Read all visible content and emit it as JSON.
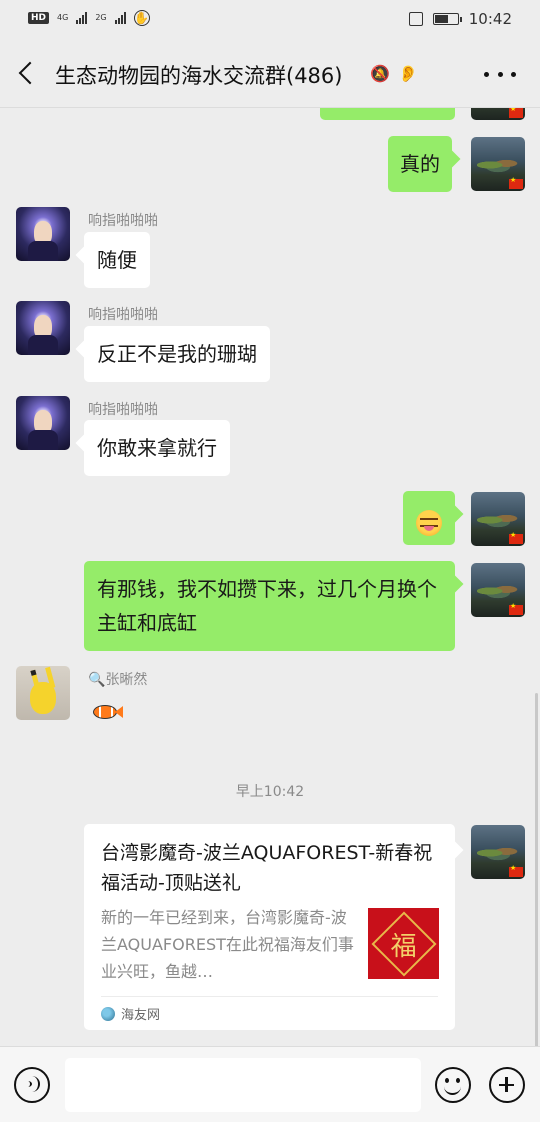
{
  "status_bar": {
    "hd": "HD",
    "net1": "4G",
    "net2": "2G",
    "time": "10:42"
  },
  "header": {
    "title": "生态动物园的海水交流群(486)"
  },
  "messages": {
    "m2": {
      "text": "真的"
    },
    "m3": {
      "sender": "响指啪啪啪",
      "text": "随便"
    },
    "m4": {
      "sender": "响指啪啪啪",
      "text": "反正不是我的珊瑚"
    },
    "m5": {
      "sender": "响指啪啪啪",
      "text": "你敢来拿就行"
    },
    "m7": {
      "text": "有那钱，我不如攒下来，过几个月换个主缸和底缸"
    },
    "m8": {
      "sender": "张晰然",
      "sender_icon": "🔍"
    }
  },
  "time_divider": "早上10:42",
  "card": {
    "title": "台湾影魔奇-波兰AQUAFOREST-新春祝福活动-顶贴送礼",
    "description": "新的一年已经到来，台湾影魔奇-波兰AQUAFOREST在此祝福海友们事业兴旺，鱼越…",
    "thumb_char": "福",
    "source": "海友网"
  },
  "input": {
    "value": ""
  },
  "colors": {
    "out_bubble": "#95ec69",
    "in_bubble": "#ffffff",
    "background": "#ededed"
  }
}
